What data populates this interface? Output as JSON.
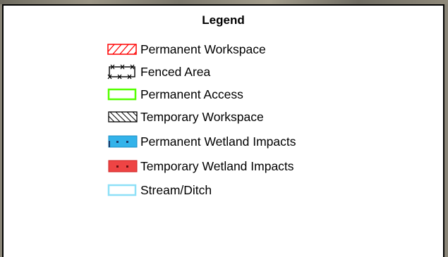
{
  "legend": {
    "title": "Legend",
    "items": [
      {
        "label": "Permanent Workspace",
        "icon": "red-hatched-box-icon",
        "color": "#ff0000"
      },
      {
        "label": "Fenced Area",
        "icon": "fence-line-box-icon",
        "color": "#000000"
      },
      {
        "label": "Permanent Access",
        "icon": "green-outline-box-icon",
        "color": "#55ff00"
      },
      {
        "label": "Temporary Workspace",
        "icon": "black-hatched-box-icon",
        "color": "#000000"
      },
      {
        "label": "Permanent Wetland Impacts",
        "icon": "blue-dotted-box-icon",
        "color": "#33b3ea"
      },
      {
        "label": "Temporary Wetland Impacts",
        "icon": "red-dotted-box-icon",
        "color": "#ee4444"
      },
      {
        "label": "Stream/Ditch",
        "icon": "cyan-outline-box-icon",
        "color": "#8ee0f7"
      }
    ]
  }
}
